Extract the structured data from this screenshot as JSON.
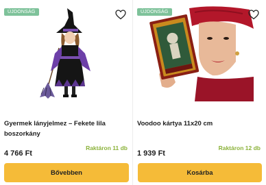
{
  "products": [
    {
      "badge": "ÚJDONSÁG",
      "title": "Gyermek lányjelmez – Fekete lila boszorkány",
      "stock": "Raktáron 11 db",
      "price": "4 766 Ft",
      "button": "Bővebben"
    },
    {
      "badge": "ÚJDONSÁG",
      "title": "Voodoo kártya 11x20 cm",
      "stock": "Raktáron 12 db",
      "price": "1 939 Ft",
      "button": "Kosárba"
    }
  ],
  "colors": {
    "badge": "#7ec29a",
    "stock": "#8bb23a",
    "button": "#f5bb38"
  },
  "icons": [
    "heart-icon",
    "witch-costume-image",
    "voodoo-card-image"
  ]
}
